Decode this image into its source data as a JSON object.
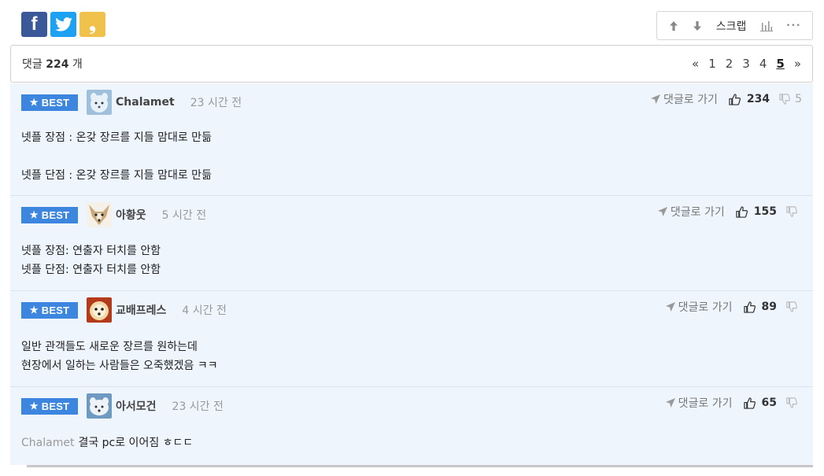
{
  "share": {
    "facebook_icon": "facebook-icon",
    "twitter_icon": "twitter-icon",
    "kakao_icon": "kakao-icon",
    "facebook_glyph": "f",
    "kakao_glyph": "❟"
  },
  "tools": {
    "upvote_icon": "arrow-up-icon",
    "downvote_icon": "arrow-down-icon",
    "scrap_label": "스크랩",
    "stats_icon": "bar-chart-icon",
    "more_icon": "more-dots-icon",
    "more_glyph": "•••"
  },
  "comment_count": {
    "prefix": "댓글",
    "number": "224",
    "suffix": "개"
  },
  "pager": {
    "prev": "«",
    "pages": [
      "1",
      "2",
      "3",
      "4",
      "5"
    ],
    "current": "5",
    "next": "»"
  },
  "comments": [
    {
      "badge": "BEST",
      "nick": "Chalamet",
      "time": "23 시간 전",
      "goto_label": "댓글로 가기",
      "likes": "234",
      "dislikes": "5",
      "lines": [
        "넷플 장점 : 온갖 장르를 지들 맘대로 만듦",
        "",
        "넷플 단점 : 온갖 장르를 지들 맘대로 만듦"
      ]
    },
    {
      "badge": "BEST",
      "nick": "아황웃",
      "time": "5 시간 전",
      "goto_label": "댓글로 가기",
      "likes": "155",
      "dislikes": "",
      "lines": [
        "넷플 장점: 연출자 터치를 안함",
        "넷플 단점: 연출자 터치를 안함"
      ]
    },
    {
      "badge": "BEST",
      "nick": "교배프레스",
      "time": "4 시간 전",
      "goto_label": "댓글로 가기",
      "likes": "89",
      "dislikes": "",
      "lines": [
        "일반 관객들도 새로운 장르를 원하는데",
        "현장에서 일하는 사람들은 오죽했겠음 ㅋㅋ"
      ]
    },
    {
      "badge": "BEST",
      "nick": "아서모건",
      "time": "23 시간 전",
      "goto_label": "댓글로 가기",
      "likes": "65",
      "dislikes": "",
      "mention": "Chalamet",
      "lines": [
        "결국 pc로 이어짐 ㅎㄷㄷ"
      ]
    }
  ],
  "colors": {
    "best_badge": "#3d86e0",
    "comment_bg": "#eff5fd",
    "facebook": "#3b5998",
    "twitter": "#1da1f2",
    "kakao": "#f0c24b"
  }
}
